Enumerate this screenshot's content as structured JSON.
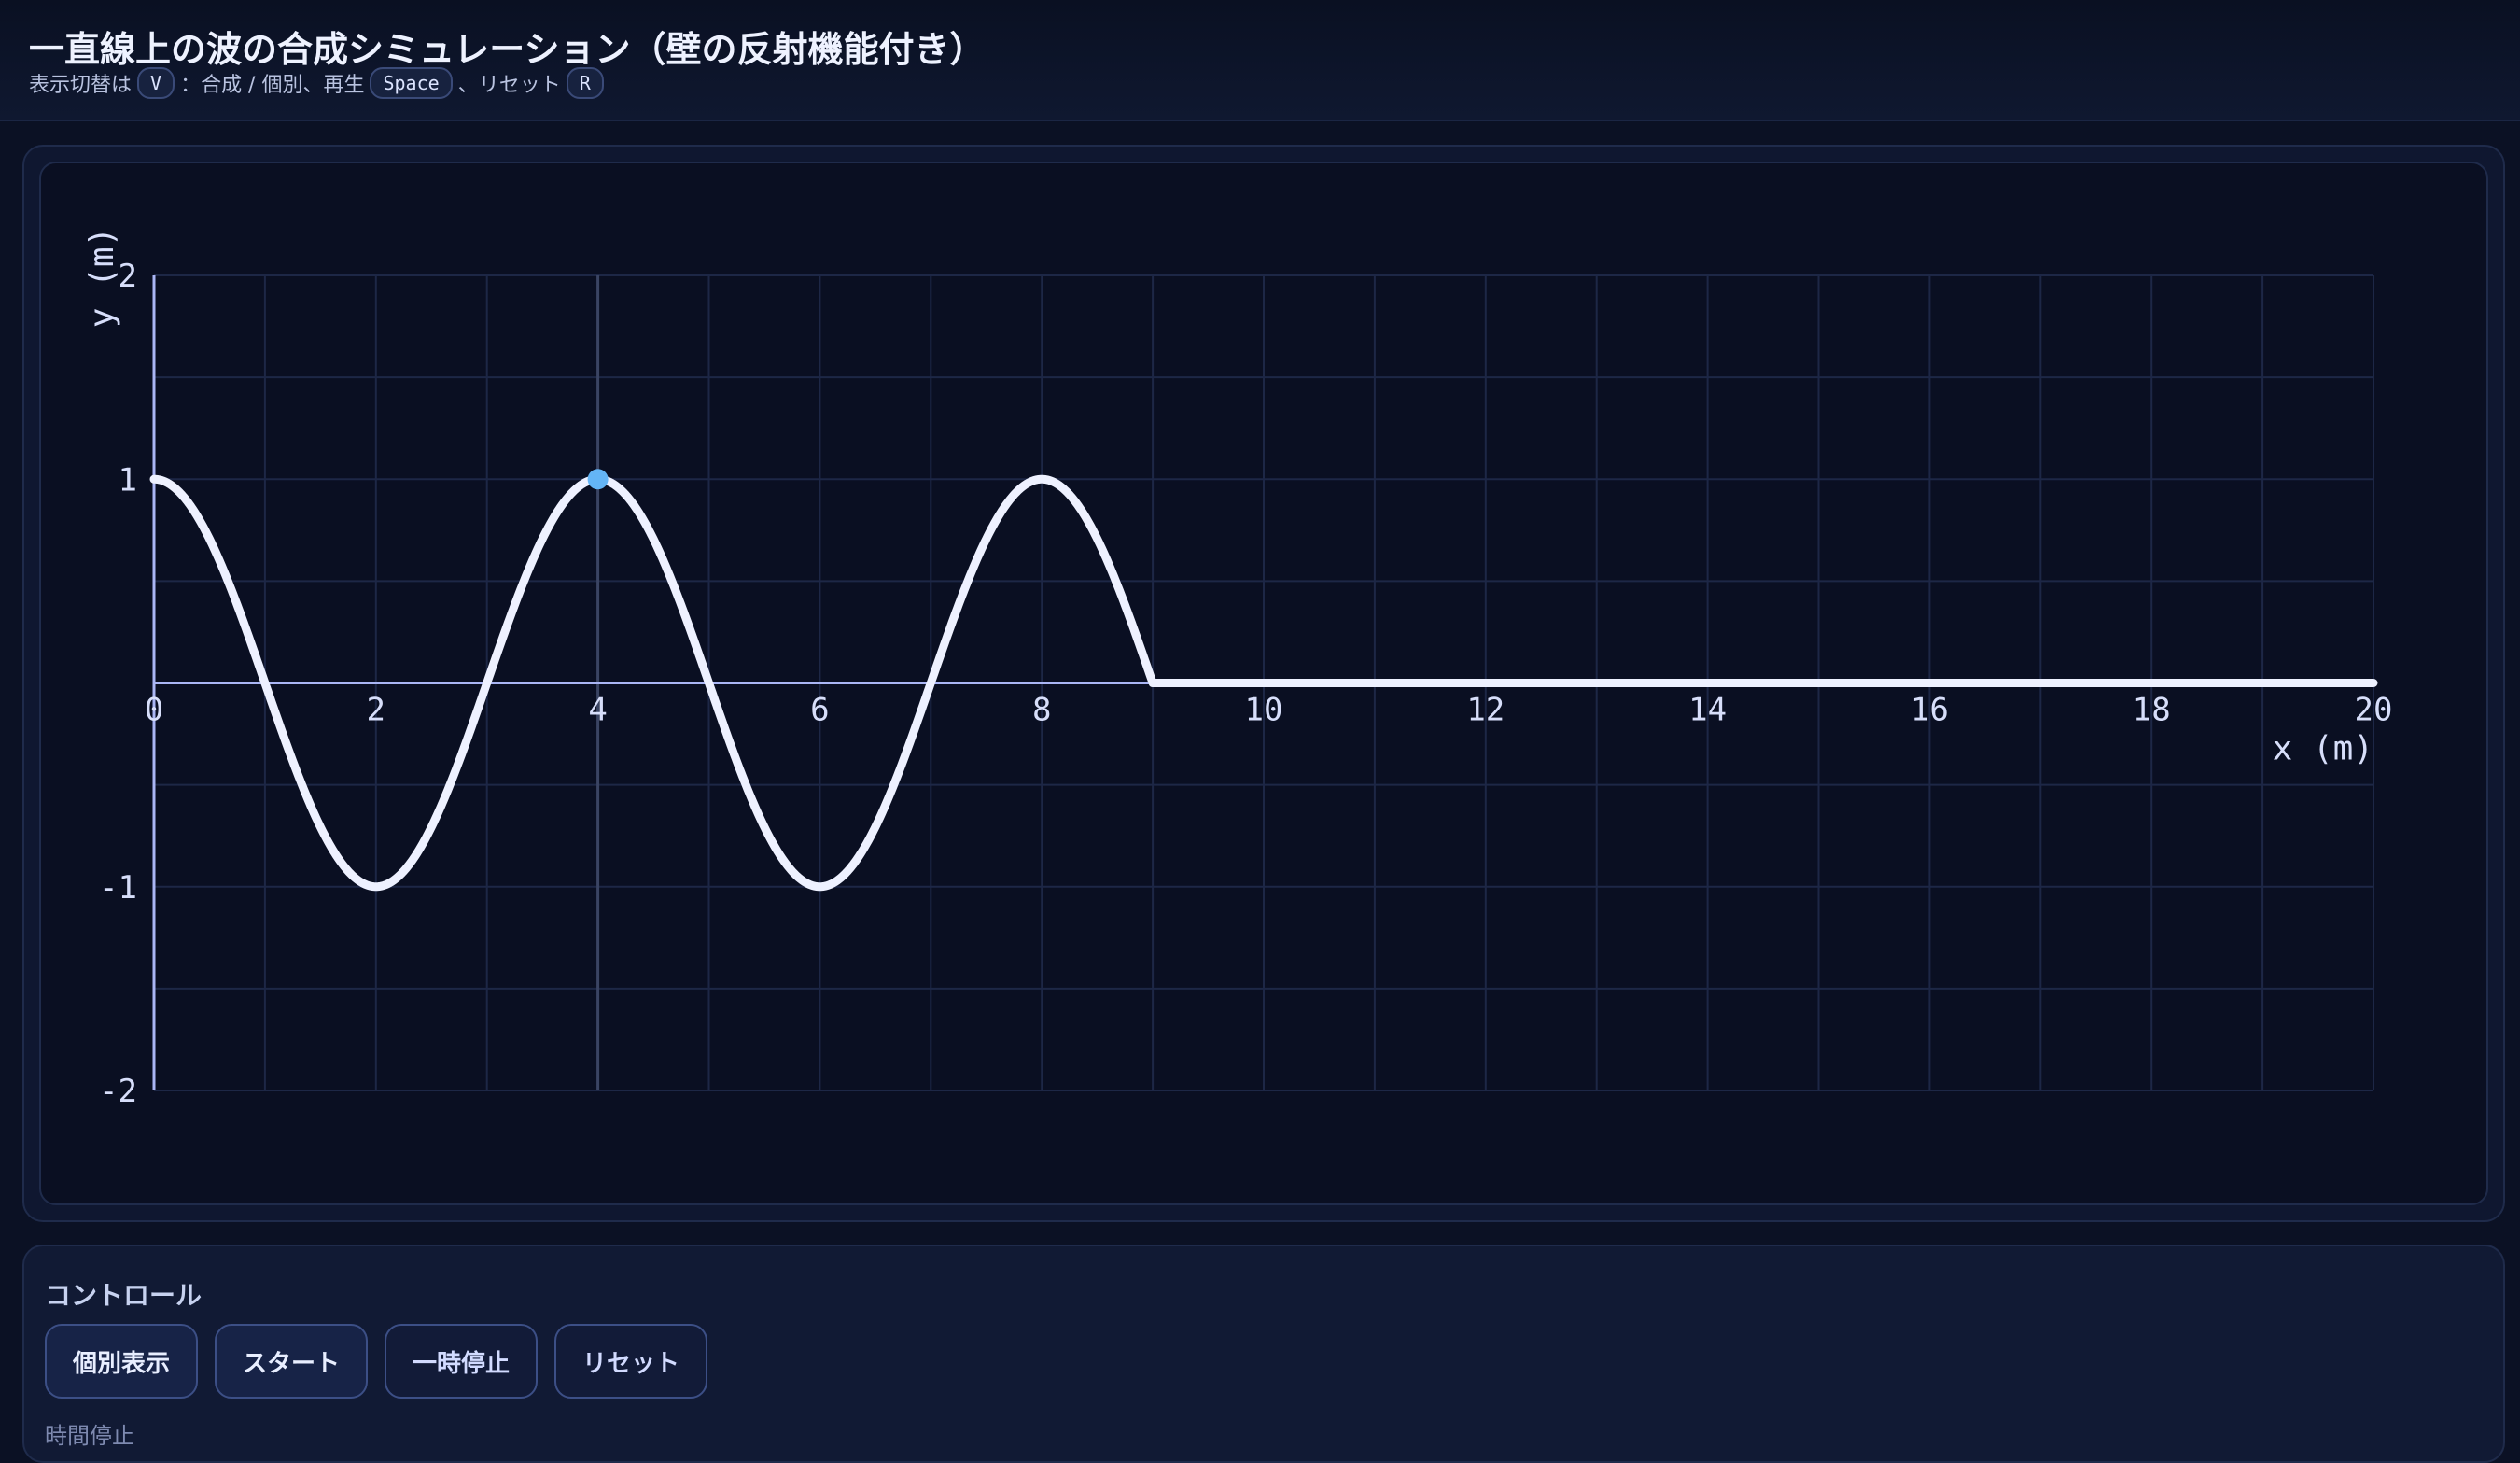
{
  "header": {
    "title": "一直線上の波の合成シミュレーション（壁の反射機能付き）",
    "sub_prefix": "表示切替は",
    "key_view": "V",
    "sub_mid1": "：合成 / 個別、再生",
    "key_play": "Space",
    "sub_mid2": "、リセット",
    "key_reset": "R"
  },
  "chart_data": {
    "type": "line",
    "xlabel": "x (m)",
    "ylabel": "y (m)",
    "xlim": [
      0,
      20
    ],
    "ylim": [
      -2,
      2
    ],
    "x_ticks": [
      "0",
      "2",
      "4",
      "6",
      "8",
      "10",
      "12",
      "14",
      "16",
      "18",
      "20"
    ],
    "y_ticks": [
      "2",
      "1",
      "-1",
      "-2"
    ],
    "grid": true,
    "wave": {
      "amplitude": 1,
      "wavelength": 4,
      "front_x": 9,
      "function": "cos"
    },
    "marker": {
      "x": 4,
      "y": 1,
      "color": "#64b5f6"
    },
    "colors": {
      "wave": "#eef1ff",
      "axis": "#aab6f5",
      "grid": "#1d2746",
      "marker_line": "#3a4463"
    }
  },
  "controls": {
    "title": "コントロール",
    "buttons": [
      {
        "label": "個別表示"
      },
      {
        "label": "スタート"
      },
      {
        "label": "一時停止"
      },
      {
        "label": "リセット"
      }
    ],
    "next_label": "時間停止"
  }
}
